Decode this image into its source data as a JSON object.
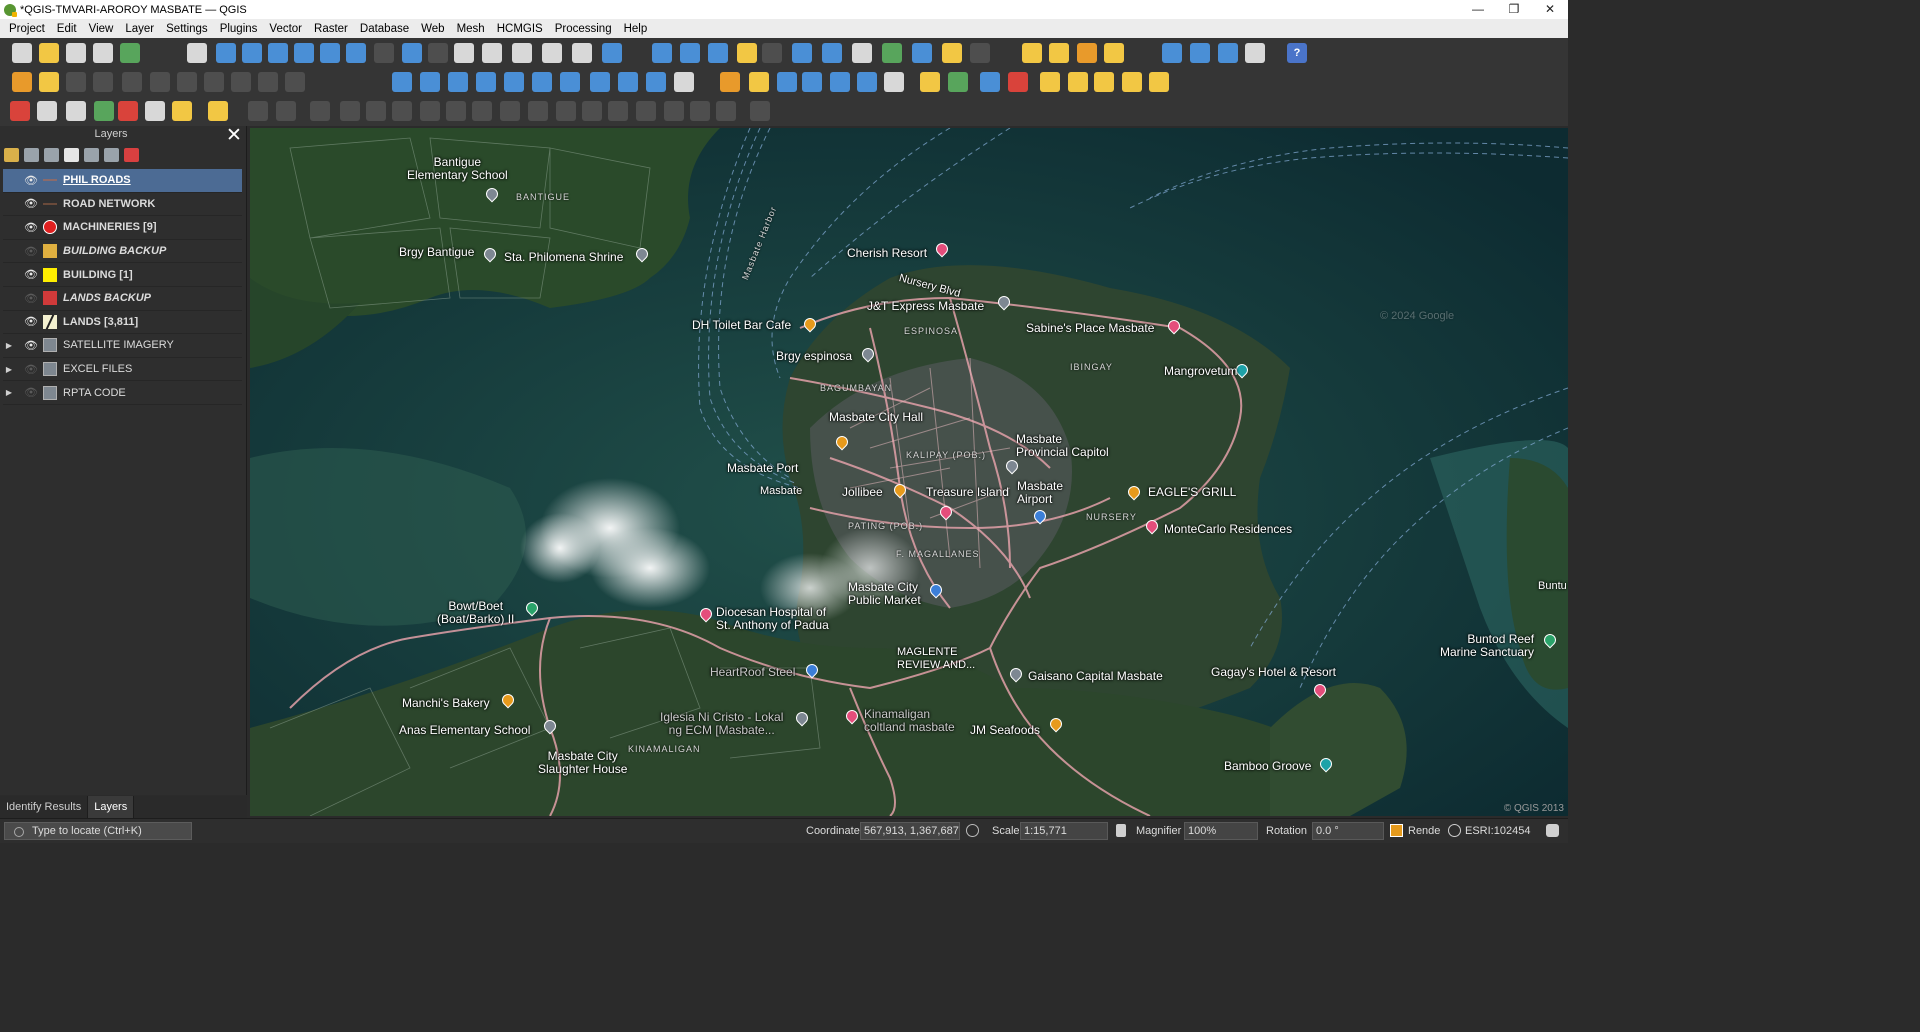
{
  "window": {
    "title": "*QGIS-TMVARI-AROROY MASBATE — QGIS",
    "minimize": "—",
    "maximize": "❐",
    "close": "✕"
  },
  "menu": [
    "Project",
    "Edit",
    "View",
    "Layer",
    "Settings",
    "Plugins",
    "Vector",
    "Raster",
    "Database",
    "Web",
    "Mesh",
    "HCMGIS",
    "Processing",
    "Help"
  ],
  "toolbar": {
    "help_label": "?"
  },
  "layers_panel": {
    "title": "Layers",
    "close_glyph": "✕",
    "layers": [
      {
        "name": "PHIL ROADS",
        "visible": true,
        "selected": true,
        "style": "link",
        "symbol": "line-dim",
        "expand": false
      },
      {
        "name": "ROAD NETWORK",
        "visible": true,
        "selected": false,
        "style": "bold",
        "symbol": "line-dark",
        "expand": false
      },
      {
        "name": "MACHINERIES [9]",
        "visible": true,
        "selected": false,
        "style": "bold",
        "symbol": "circle-red",
        "expand": false
      },
      {
        "name": "BUILDING BACKUP",
        "visible": false,
        "selected": false,
        "style": "italic",
        "symbol": "sq-yellow-dim",
        "expand": false
      },
      {
        "name": "BUILDING [1]",
        "visible": true,
        "selected": false,
        "style": "bold",
        "symbol": "sq-yellow",
        "expand": false
      },
      {
        "name": "LANDS BACKUP",
        "visible": false,
        "selected": false,
        "style": "italic",
        "symbol": "sq-red",
        "expand": false
      },
      {
        "name": "LANDS [3,811]",
        "visible": true,
        "selected": false,
        "style": "bold",
        "symbol": "slash",
        "expand": false
      },
      {
        "name": "SATELLITE IMAGERY",
        "visible": true,
        "selected": false,
        "style": "plain",
        "symbol": "group",
        "expand": true
      },
      {
        "name": "EXCEL FILES",
        "visible": false,
        "selected": false,
        "style": "plain",
        "symbol": "group",
        "expand": true
      },
      {
        "name": "RPTA CODE",
        "visible": false,
        "selected": false,
        "style": "plain",
        "symbol": "group",
        "expand": true
      }
    ],
    "tabs": [
      "Identify Results",
      "Layers"
    ],
    "active_tab": "Layers"
  },
  "map": {
    "places": [
      {
        "text": "Bantigue\nElementary School",
        "key": "p1"
      },
      {
        "text": "Brgy Bantigue",
        "key": "p2"
      },
      {
        "text": "Sta. Philomena Shrine",
        "key": "p3"
      },
      {
        "text": "Cherish Resort",
        "key": "p4"
      },
      {
        "text": "Nursery Blvd",
        "key": "p5"
      },
      {
        "text": "J&T Express Masbate",
        "key": "p6"
      },
      {
        "text": "DH Toilet Bar Cafe",
        "key": "p7"
      },
      {
        "text": "Sabine's Place Masbate",
        "key": "p8"
      },
      {
        "text": "Brgy espinosa",
        "key": "p9"
      },
      {
        "text": "Mangrovetum",
        "key": "p10"
      },
      {
        "text": "Masbate City Hall",
        "key": "p11"
      },
      {
        "text": "Masbate\nProvincial Capitol",
        "key": "p12"
      },
      {
        "text": "Masbate Port",
        "key": "p13"
      },
      {
        "text": "Masbate",
        "key": "p14"
      },
      {
        "text": "Jollibee",
        "key": "p15"
      },
      {
        "text": "Treasure Island",
        "key": "p16"
      },
      {
        "text": "Masbate\nAirport",
        "key": "p17"
      },
      {
        "text": "EAGLE'S GRILL",
        "key": "p18"
      },
      {
        "text": "MonteCarlo Residences",
        "key": "p19"
      },
      {
        "text": "Bowt/Boet\n(Boat/Barko) II",
        "key": "p20"
      },
      {
        "text": "Diocesan Hospital of\nSt. Anthony of Padua",
        "key": "p21"
      },
      {
        "text": "Masbate City\nPublic Market",
        "key": "p22"
      },
      {
        "text": "MAGLENTE\nREVIEW AND...",
        "key": "p23"
      },
      {
        "text": "HeartRoof Steel",
        "key": "p24"
      },
      {
        "text": "Gaisano Capital Masbate",
        "key": "p25"
      },
      {
        "text": "Gagay's Hotel & Resort",
        "key": "p26"
      },
      {
        "text": "Buntod Reef\nMarine Sanctuary",
        "key": "p27"
      },
      {
        "text": "Manchi's Bakery",
        "key": "p28"
      },
      {
        "text": "Anas Elementary School",
        "key": "p29"
      },
      {
        "text": "Iglesia Ni Cristo - Lokal\nng ECM [Masbate...",
        "key": "p30"
      },
      {
        "text": "Kinamaligan\ncoltland masbate",
        "key": "p31"
      },
      {
        "text": "JM Seafoods",
        "key": "p32"
      },
      {
        "text": "Masbate City\nSlaughter House",
        "key": "p33"
      },
      {
        "text": "Bamboo Groove",
        "key": "p34"
      },
      {
        "text": "Buntu",
        "key": "p35"
      }
    ],
    "districts": [
      "BANTIGUE",
      "ESPINOSA",
      "BAGUMBAYAN",
      "IBINGAY",
      "KALIPAY (POB.)",
      "PATING (POB.)",
      "F. MAGALLANES",
      "NURSERY",
      "KINAMALIGAN"
    ],
    "harbor_label": "Masbate Harbor",
    "watermark": "© 2024 Google",
    "copyright": "&copy; QGIS 2013"
  },
  "statusbar": {
    "locator_placeholder": "Type to locate (Ctrl+K)",
    "coordinate_label": "Coordinate",
    "coordinate_value": "567,913, 1,367,687",
    "scale_label": "Scale",
    "scale_value": "1:15,771",
    "magnifier_label": "Magnifier",
    "magnifier_value": "100%",
    "rotation_label": "Rotation",
    "rotation_value": "0.0 °",
    "render_label": "Render",
    "crs": "ESRI:102454"
  },
  "colors": {
    "selected_layer": "#4c6b94",
    "road": "#e2a0a8",
    "sea_deep": "#0f2e35",
    "land": "#2f4a2e"
  }
}
